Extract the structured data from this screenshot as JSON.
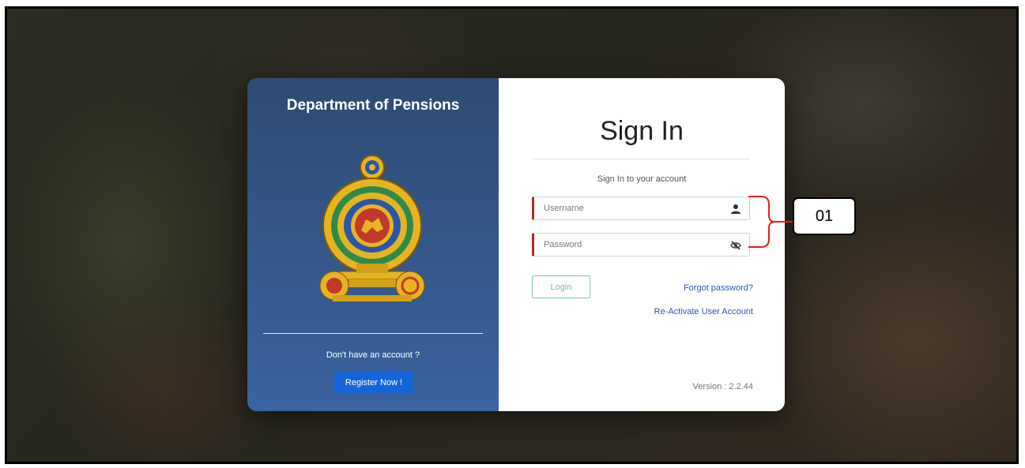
{
  "left_panel": {
    "title": "Department of Pensions",
    "emblem_icon": "sri-lanka-emblem",
    "no_account_text": "Don't have an account ?",
    "register_label": "Register Now !"
  },
  "sign_in": {
    "title": "Sign In",
    "subtitle": "Sign In to your account",
    "username_placeholder": "Username",
    "username_icon": "user-icon",
    "password_placeholder": "Password",
    "password_icon": "eye-slash-icon",
    "login_label": "Login",
    "forgot_password": "Forgot password?",
    "reactivate_account": "Re-Activate User Account",
    "version": "Version : 2.2.44"
  },
  "annotation": {
    "label": "01",
    "color": "#e02020"
  },
  "colors": {
    "left_panel_top": "#2f4b72",
    "left_panel_bottom": "#3a63a0",
    "register_button": "#1565d8",
    "field_accent": "#b22a2a",
    "login_border": "#7cc8a0",
    "link": "#2457b8"
  }
}
